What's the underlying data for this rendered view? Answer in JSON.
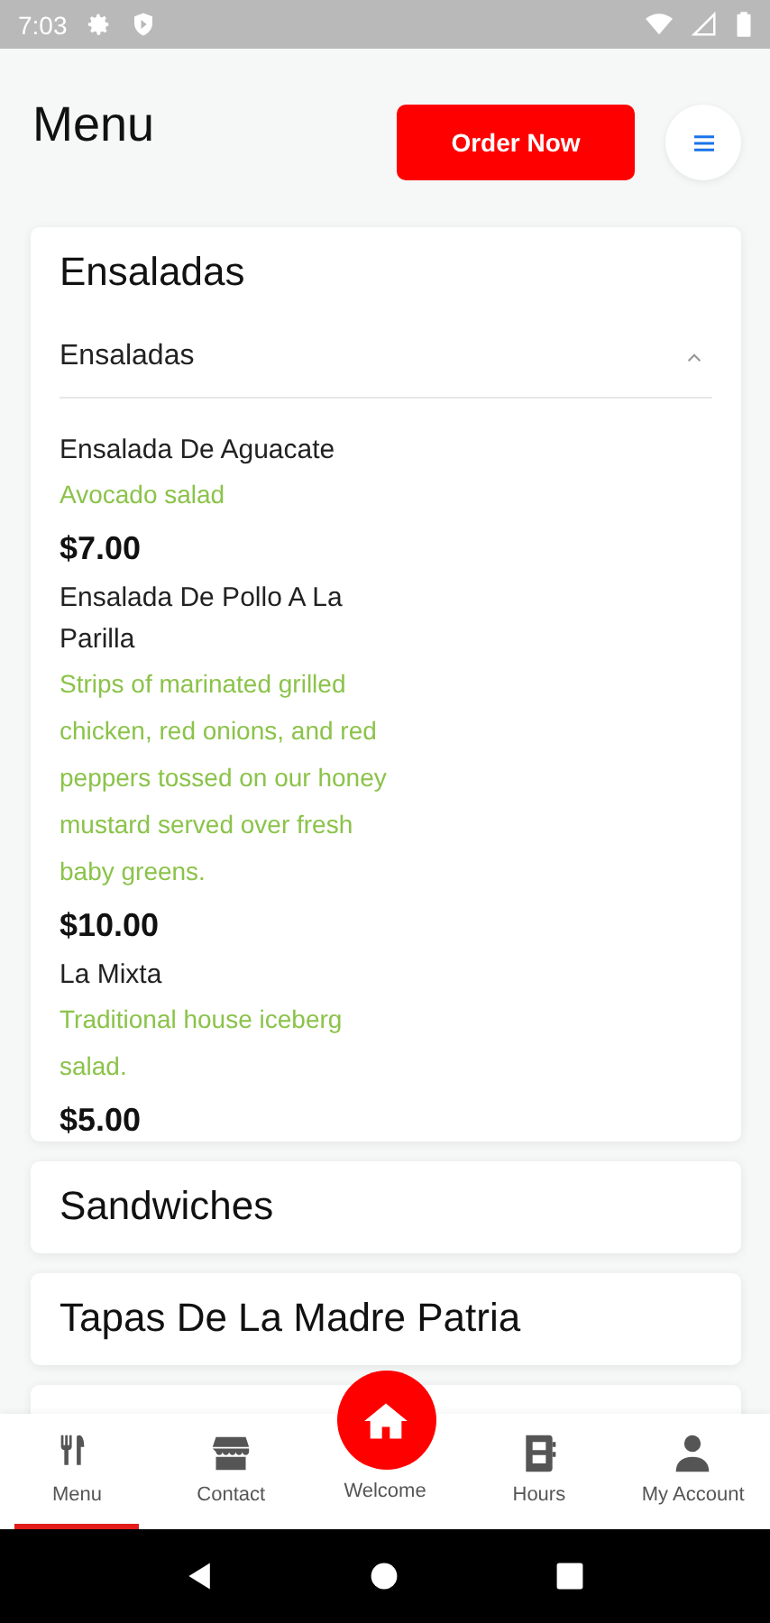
{
  "status_bar": {
    "time": "7:03"
  },
  "header": {
    "title": "Menu",
    "order_button": "Order Now"
  },
  "sections": [
    {
      "title": "Ensaladas",
      "subsections": [
        {
          "title": "Ensaladas",
          "expanded": true,
          "items": [
            {
              "name": "Ensalada De Aguacate",
              "description": "Avocado salad",
              "price": "$7.00"
            },
            {
              "name": "Ensalada De Pollo A La Parilla",
              "description": "Strips of marinated grilled chicken, red onions, and red peppers tossed on our honey mustard served over fresh baby greens.",
              "price": "$10.00"
            },
            {
              "name": "La Mixta",
              "description": "Traditional house iceberg salad.",
              "price": "$5.00"
            }
          ]
        }
      ]
    },
    {
      "title": "Sandwiches"
    },
    {
      "title": "Tapas De La Madre Patria"
    }
  ],
  "bottom_nav": [
    {
      "label": "Menu",
      "selected": true
    },
    {
      "label": "Contact",
      "selected": false
    },
    {
      "label": "Welcome",
      "selected": false,
      "kind": "fab"
    },
    {
      "label": "Hours",
      "selected": false
    },
    {
      "label": "My Account",
      "selected": false
    }
  ]
}
